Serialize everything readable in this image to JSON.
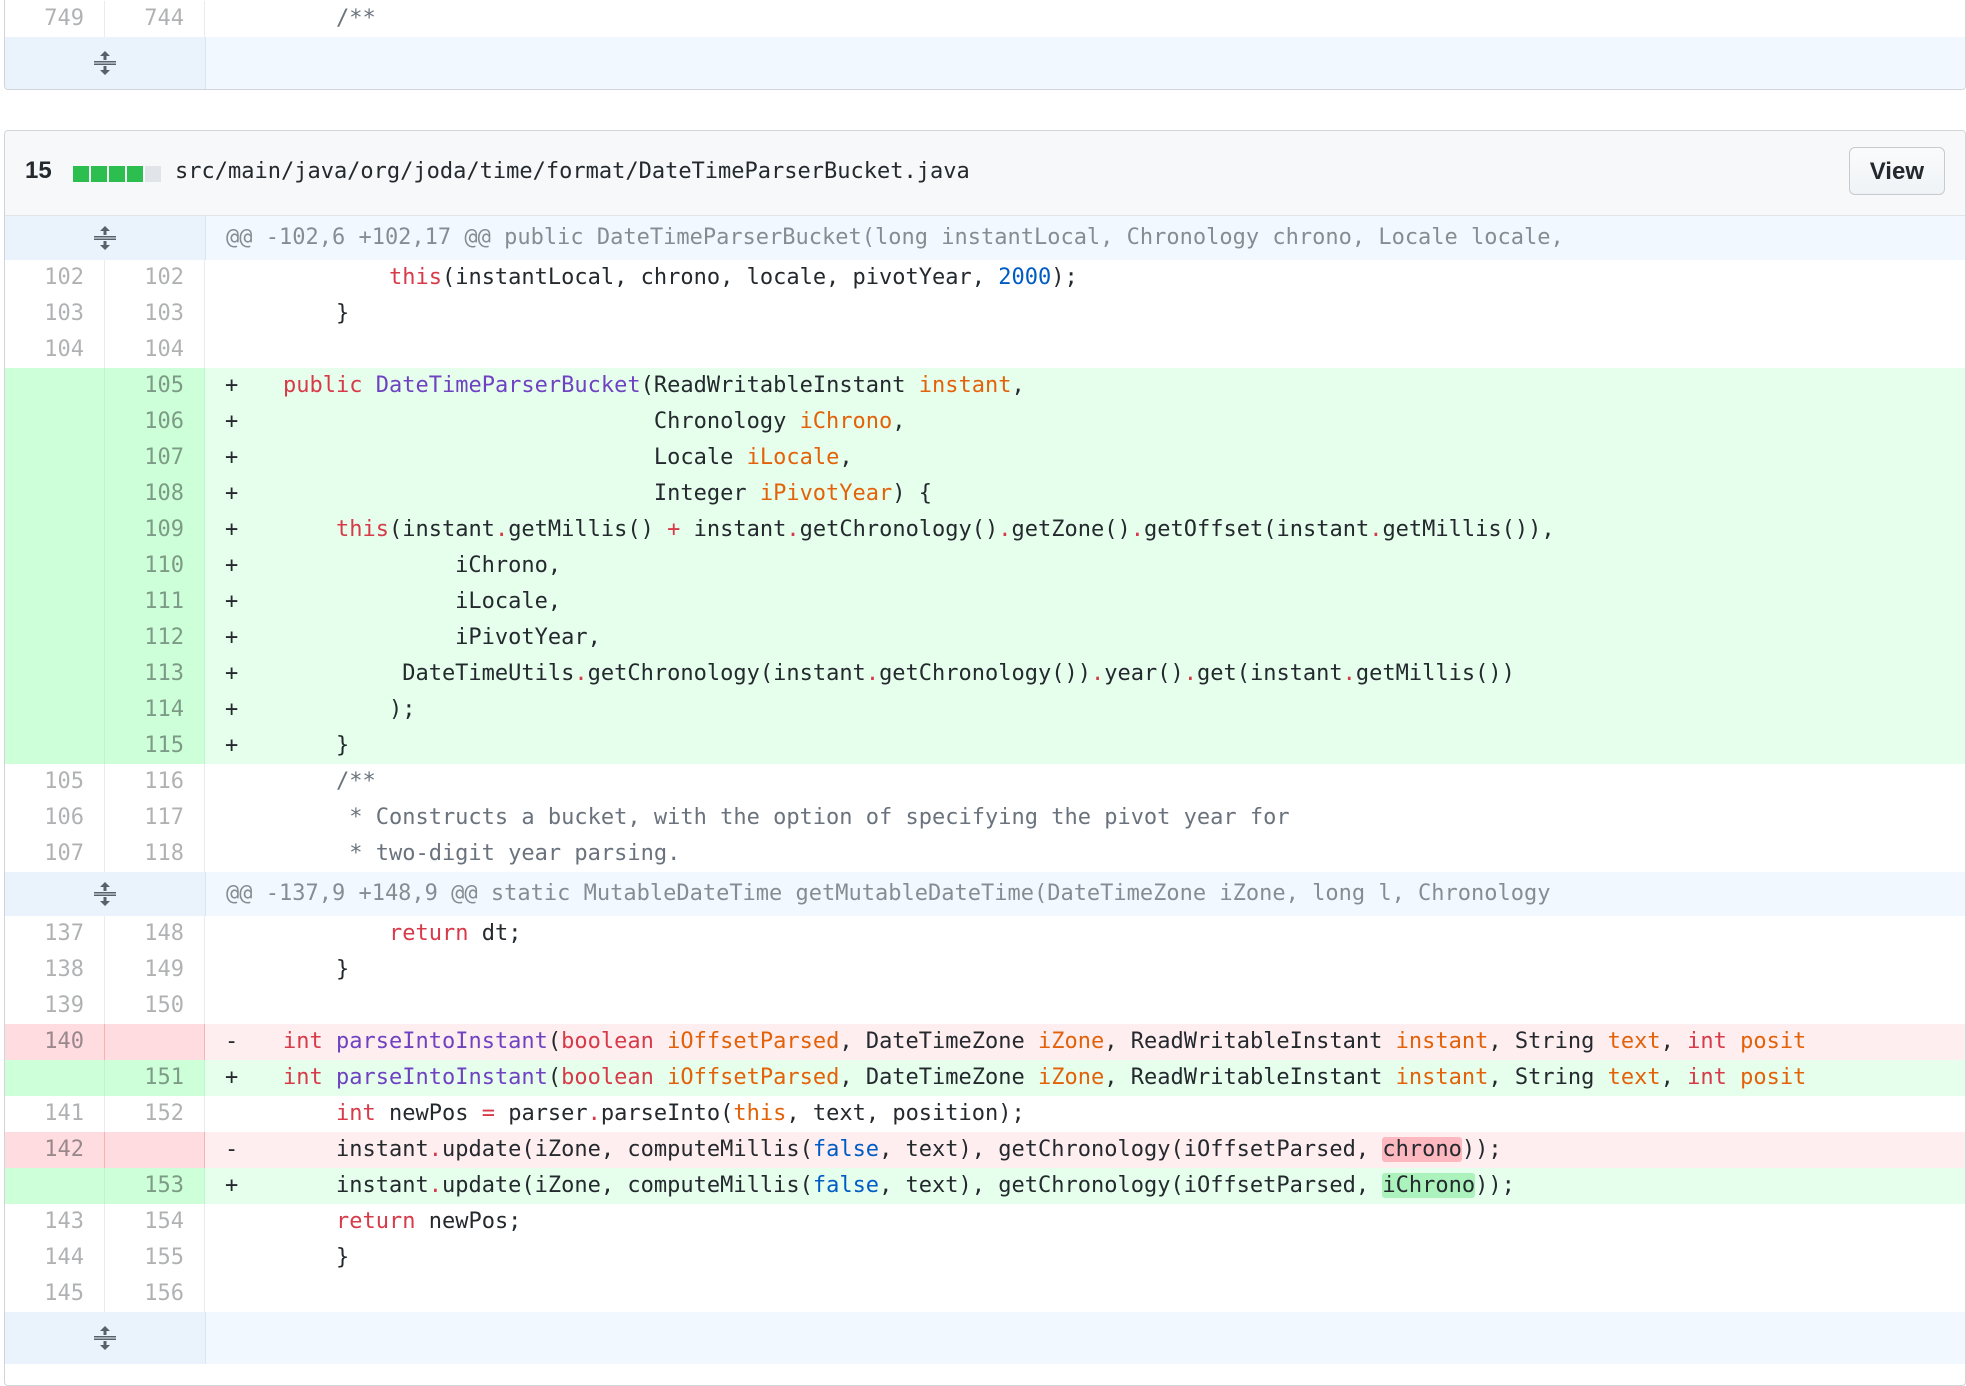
{
  "file_a": {
    "rows": [
      {
        "type": "ctx",
        "old": "749",
        "new": "744",
        "marker": "",
        "code": "    /**"
      }
    ]
  },
  "file_b": {
    "diffstat_count": "15",
    "diffstat_colors": [
      "#2cbe4e",
      "#2cbe4e",
      "#2cbe4e",
      "#2cbe4e",
      "#e1e4e8"
    ],
    "path": "src/main/java/org/joda/time/format/DateTimeParserBucket.java",
    "view_label": "View",
    "hunk1": "@@ -102,6 +102,17 @@ public DateTimeParserBucket(long instantLocal, Chronology chrono, Locale locale,",
    "hunk2": "@@ -137,9 +148,9 @@ static MutableDateTime getMutableDateTime(DateTimeZone iZone, long l, Chronology",
    "lines": {
      "l102": {
        "old": "102",
        "new": "102"
      },
      "l103": {
        "old": "103",
        "new": "103",
        "code": "    }"
      },
      "l104": {
        "old": "104",
        "new": "104"
      },
      "a105": {
        "new": "105",
        "marker": "+"
      },
      "a106": {
        "new": "106",
        "marker": "+"
      },
      "a107": {
        "new": "107",
        "marker": "+"
      },
      "a108": {
        "new": "108",
        "marker": "+"
      },
      "a109": {
        "new": "109",
        "marker": "+"
      },
      "a110": {
        "new": "110",
        "marker": "+",
        "code": "             iChrono,"
      },
      "a111": {
        "new": "111",
        "marker": "+",
        "code": "             iLocale,"
      },
      "a112": {
        "new": "112",
        "marker": "+",
        "code": "             iPivotYear,"
      },
      "a113": {
        "new": "113",
        "marker": "+"
      },
      "a114": {
        "new": "114",
        "marker": "+",
        "code": "        );"
      },
      "a115": {
        "new": "115",
        "marker": "+",
        "code": "    }"
      },
      "l105": {
        "old": "105",
        "new": "116",
        "code": "    /**"
      },
      "l106": {
        "old": "106",
        "new": "117",
        "code": "     * Constructs a bucket, with the option of specifying the pivot year for"
      },
      "l107": {
        "old": "107",
        "new": "118",
        "code": "     * two-digit year parsing."
      },
      "l137": {
        "old": "137",
        "new": "148"
      },
      "l138": {
        "old": "138",
        "new": "149",
        "code": "    }"
      },
      "l139": {
        "old": "139",
        "new": "150"
      },
      "d140": {
        "old": "140",
        "marker": "-"
      },
      "a151": {
        "new": "151",
        "marker": "+"
      },
      "l141": {
        "old": "141",
        "new": "152"
      },
      "d142": {
        "old": "142",
        "marker": "-"
      },
      "a153": {
        "new": "153",
        "marker": "+"
      },
      "l143": {
        "old": "143",
        "new": "154"
      },
      "l144": {
        "old": "144",
        "new": "155",
        "code": "    }"
      },
      "l145": {
        "old": "145",
        "new": "156"
      }
    }
  },
  "colors": {
    "add_bg": "#e6ffed",
    "add_num_bg": "#cdffd8",
    "del_bg": "#ffeef0",
    "del_num_bg": "#ffdce0",
    "hunk_bg": "#f1f8ff",
    "keyword": "#d73a49",
    "function": "#6f42c1",
    "variable": "#e36209",
    "constant": "#005cc5"
  },
  "icons": {
    "expand": "unfold-icon"
  }
}
